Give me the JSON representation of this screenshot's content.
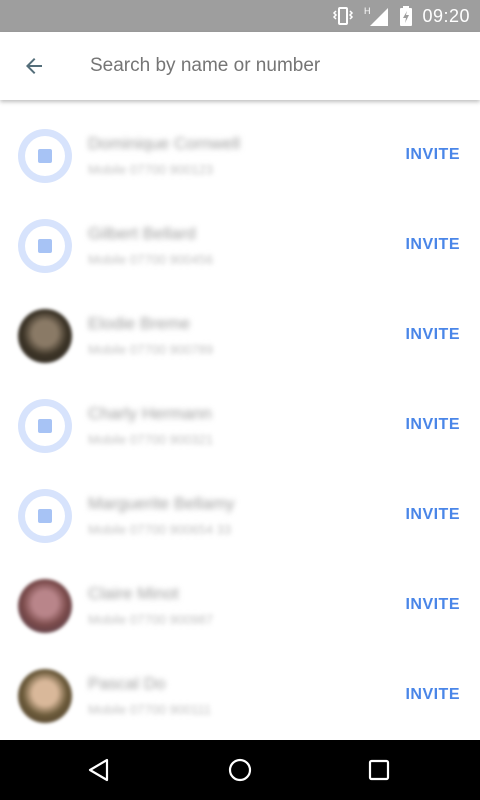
{
  "status_bar": {
    "time": "09:20",
    "icons": [
      "vibrate-icon",
      "network-h-icon",
      "signal-icon",
      "battery-charging-icon"
    ]
  },
  "search": {
    "placeholder": "Search by name or number",
    "value": "",
    "back_icon": "arrow-left-icon"
  },
  "contacts": [
    {
      "name": "Dominique Cornwell",
      "detail": "Mobile 07700 900123",
      "avatar": "placeholder",
      "invite_label": "INVITE"
    },
    {
      "name": "Gilbert Bellard",
      "detail": "Mobile 07700 900456",
      "avatar": "placeholder",
      "invite_label": "INVITE"
    },
    {
      "name": "Elodie Breme",
      "detail": "Mobile 07700 900789",
      "avatar": "photo",
      "photo_colors": [
        "#3b3326",
        "#8a7a66",
        "#2e2a24"
      ],
      "invite_label": "INVITE"
    },
    {
      "name": "Charly Hermann",
      "detail": "Mobile 07700 900321",
      "avatar": "placeholder",
      "invite_label": "INVITE"
    },
    {
      "name": "Marguerite Bellamy",
      "detail": "Mobile 07700 900654 33",
      "avatar": "placeholder",
      "invite_label": "INVITE"
    },
    {
      "name": "Claire Minot",
      "detail": "Mobile 07700 900987",
      "avatar": "photo",
      "photo_colors": [
        "#7a4a4a",
        "#b9858a",
        "#4a3a4a"
      ],
      "invite_label": "INVITE"
    },
    {
      "name": "Pascal Do",
      "detail": "Mobile 07700 900111",
      "avatar": "photo",
      "photo_colors": [
        "#6b5a3a",
        "#d9b89a",
        "#4a3a2a"
      ],
      "invite_label": "INVITE"
    }
  ],
  "nav_bar": {
    "buttons": [
      "back-icon",
      "home-icon",
      "recents-icon"
    ]
  },
  "colors": {
    "accent": "#4a86e8",
    "status_bar": "#9e9e9e",
    "nav_bar": "#000000",
    "avatar_placeholder": "#d7e3fc"
  }
}
